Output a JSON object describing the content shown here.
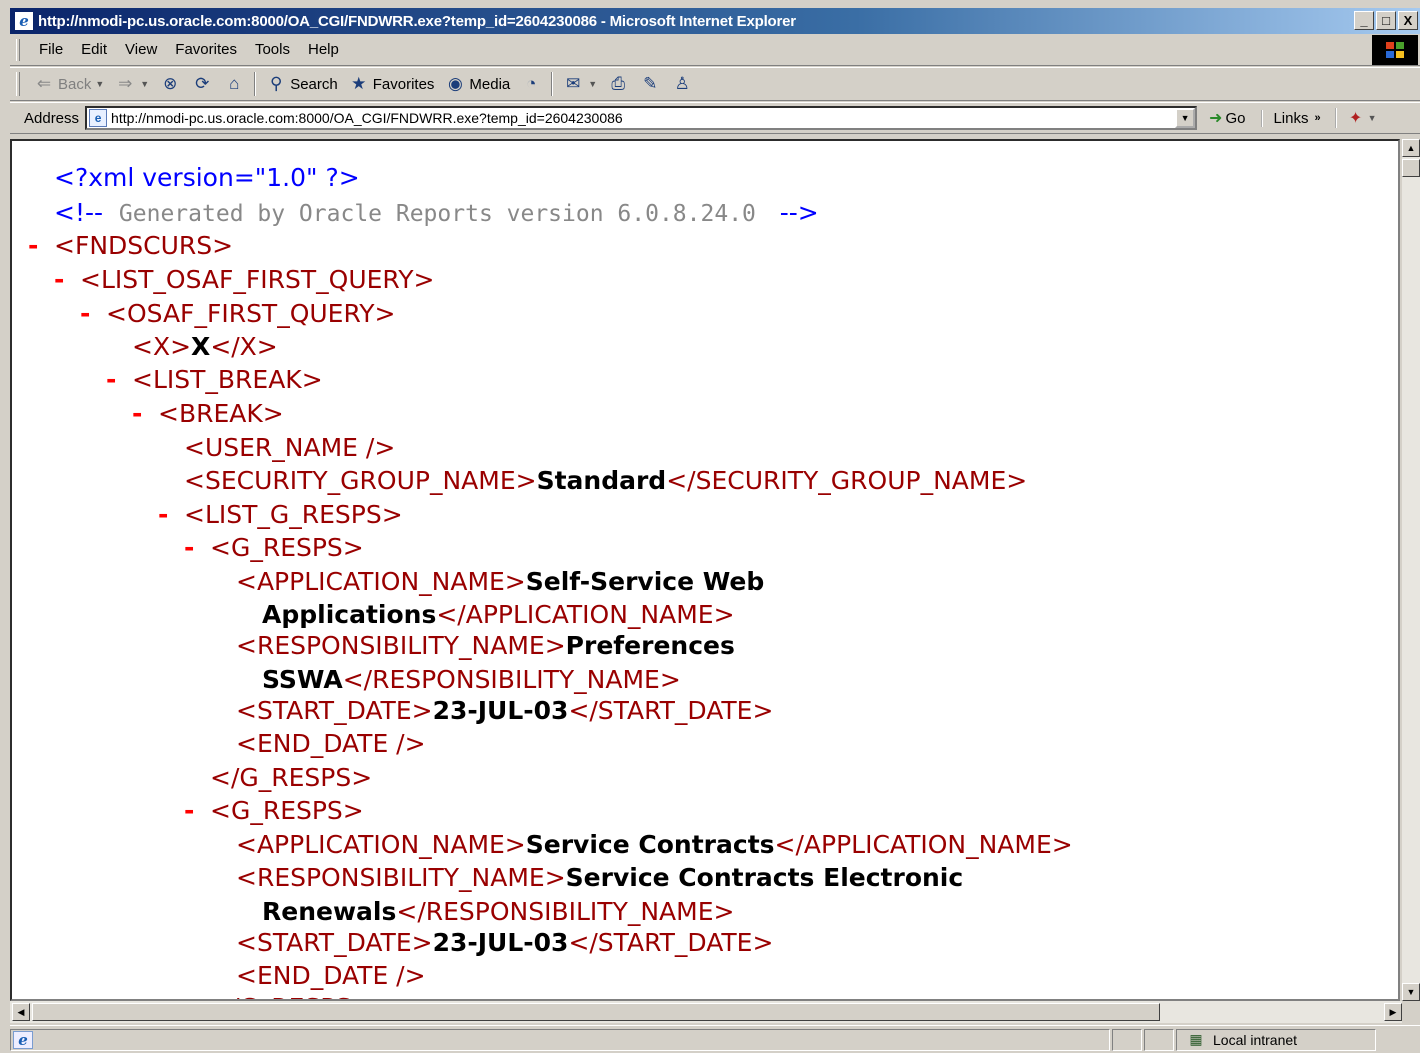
{
  "window": {
    "title": "http://nmodi-pc.us.oracle.com:8000/OA_CGI/FNDWRR.exe?temp_id=2604230086 - Microsoft Internet Explorer",
    "buttons": {
      "minimize": "_",
      "maximize": "□",
      "close": "X"
    }
  },
  "menu": {
    "items": [
      "File",
      "Edit",
      "View",
      "Favorites",
      "Tools",
      "Help"
    ]
  },
  "toolbar": {
    "back_label": "Back",
    "search_label": "Search",
    "favorites_label": "Favorites",
    "media_label": "Media",
    "icons": [
      "back-arrow-icon",
      "forward-arrow-icon",
      "stop-icon",
      "refresh-icon",
      "home-icon",
      "search-icon",
      "favorites-icon",
      "media-icon",
      "history-icon",
      "mail-icon",
      "print-icon",
      "edit-icon",
      "messenger-icon"
    ]
  },
  "address": {
    "label": "Address",
    "url": "http://nmodi-pc.us.oracle.com:8000/OA_CGI/FNDWRR.exe?temp_id=2604230086",
    "go_label": "Go",
    "links_label": "Links"
  },
  "xml": {
    "pi": "<?xml version=\"1.0\" ?>",
    "comment_open": "<!--",
    "comment_text": "Generated by Oracle Reports version 6.0.8.24.0",
    "comment_close": "-->",
    "minus": "-",
    "fndscurs_open": "<FNDSCURS>",
    "list_osaf_open": "<LIST_OSAF_FIRST_QUERY>",
    "osaf_open": "<OSAF_FIRST_QUERY>",
    "x_open": "<X>",
    "x_value": "X",
    "x_close": "</X>",
    "list_break_open": "<LIST_BREAK>",
    "break_open": "<BREAK>",
    "user_name": "<USER_NAME />",
    "sec_group_open": "<SECURITY_GROUP_NAME>",
    "sec_group_value": "Standard",
    "sec_group_close": "</SECURITY_GROUP_NAME>",
    "list_g_resps_open": "<LIST_G_RESPS>",
    "g_resps_open": "<G_RESPS>",
    "g_resps_close": "</G_RESPS>",
    "app_name_open": "<APPLICATION_NAME>",
    "app_name_close": "</APPLICATION_NAME>",
    "resp_name_open": "<RESPONSIBILITY_NAME>",
    "resp_name_close": "</RESPONSIBILITY_NAME>",
    "start_date_open": "<START_DATE>",
    "start_date_close": "</START_DATE>",
    "end_date": "<END_DATE />",
    "records": [
      {
        "app_name_line1": "Self-Service Web",
        "app_name_line2": "Applications",
        "resp_name_line1": "Preferences",
        "resp_name_line2": "SSWA",
        "start_date": "23-JUL-03"
      },
      {
        "app_name": "Service Contracts",
        "resp_name_line1": "Service Contracts Electronic",
        "resp_name_line2": "Renewals",
        "start_date": "23-JUL-03"
      }
    ]
  },
  "status": {
    "zone_label": "Local intranet"
  }
}
